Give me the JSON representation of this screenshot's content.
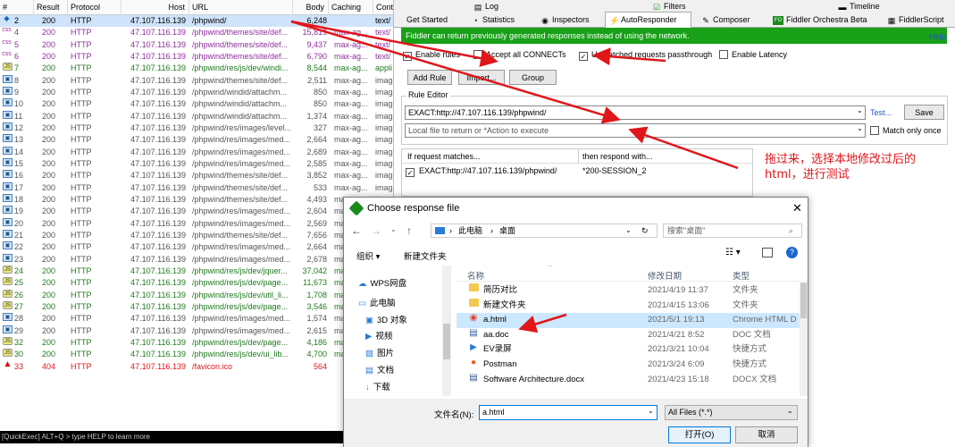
{
  "sessions": {
    "headers": [
      "#",
      "Result",
      "Protocol",
      "Host",
      "URL",
      "Body",
      "Caching",
      "Cont"
    ],
    "rows": [
      {
        "num": "2",
        "result": "200",
        "protocol": "HTTP",
        "host": "47.107.116.139",
        "url": "/phpwind/",
        "body": "6,248",
        "caching": "",
        "content": "text/",
        "icon": "nav",
        "color": "#000000"
      },
      {
        "num": "4",
        "result": "200",
        "protocol": "HTTP",
        "host": "47.107.116.139",
        "url": "/phpwind/themes/site/def...",
        "body": "15,819",
        "caching": "max-ag...",
        "content": "text/",
        "icon": "css",
        "color": "#8e2f9c"
      },
      {
        "num": "5",
        "result": "200",
        "protocol": "HTTP",
        "host": "47.107.116.139",
        "url": "/phpwind/themes/site/def...",
        "body": "9,437",
        "caching": "max-ag...",
        "content": "text/",
        "icon": "css",
        "color": "#8e2f9c"
      },
      {
        "num": "6",
        "result": "200",
        "protocol": "HTTP",
        "host": "47.107.116.139",
        "url": "/phpwind/themes/site/def...",
        "body": "6,790",
        "caching": "max-ag...",
        "content": "text/",
        "icon": "css",
        "color": "#8e2f9c"
      },
      {
        "num": "7",
        "result": "200",
        "protocol": "HTTP",
        "host": "47.107.116.139",
        "url": "/phpwind/res/js/dev/windi...",
        "body": "8,544",
        "caching": "max-ag...",
        "content": "appli",
        "icon": "js",
        "color": "#1f7a1f"
      },
      {
        "num": "8",
        "result": "200",
        "protocol": "HTTP",
        "host": "47.107.116.139",
        "url": "/phpwind/themes/site/def...",
        "body": "2,511",
        "caching": "max-ag...",
        "content": "imag",
        "icon": "img",
        "color": "#555555"
      },
      {
        "num": "9",
        "result": "200",
        "protocol": "HTTP",
        "host": "47.107.116.139",
        "url": "/phpwind/windid/attachm...",
        "body": "850",
        "caching": "max-ag...",
        "content": "imag",
        "icon": "img",
        "color": "#555555"
      },
      {
        "num": "10",
        "result": "200",
        "protocol": "HTTP",
        "host": "47.107.116.139",
        "url": "/phpwind/windid/attachm...",
        "body": "850",
        "caching": "max-ag...",
        "content": "imag",
        "icon": "img",
        "color": "#555555"
      },
      {
        "num": "11",
        "result": "200",
        "protocol": "HTTP",
        "host": "47.107.116.139",
        "url": "/phpwind/windid/attachm...",
        "body": "1,374",
        "caching": "max-ag...",
        "content": "imag",
        "icon": "img",
        "color": "#555555"
      },
      {
        "num": "12",
        "result": "200",
        "protocol": "HTTP",
        "host": "47.107.116.139",
        "url": "/phpwind/res/images/level...",
        "body": "327",
        "caching": "max-ag...",
        "content": "imag",
        "icon": "img",
        "color": "#555555"
      },
      {
        "num": "13",
        "result": "200",
        "protocol": "HTTP",
        "host": "47.107.116.139",
        "url": "/phpwind/res/images/med...",
        "body": "2,664",
        "caching": "max-ag...",
        "content": "imag",
        "icon": "img",
        "color": "#555555"
      },
      {
        "num": "14",
        "result": "200",
        "protocol": "HTTP",
        "host": "47.107.116.139",
        "url": "/phpwind/res/images/med...",
        "body": "2,689",
        "caching": "max-ag...",
        "content": "imag",
        "icon": "img",
        "color": "#555555"
      },
      {
        "num": "15",
        "result": "200",
        "protocol": "HTTP",
        "host": "47.107.116.139",
        "url": "/phpwind/res/images/med...",
        "body": "2,585",
        "caching": "max-ag...",
        "content": "imag",
        "icon": "img",
        "color": "#555555"
      },
      {
        "num": "16",
        "result": "200",
        "protocol": "HTTP",
        "host": "47.107.116.139",
        "url": "/phpwind/themes/site/def...",
        "body": "3,852",
        "caching": "max-ag...",
        "content": "imag",
        "icon": "img",
        "color": "#555555"
      },
      {
        "num": "17",
        "result": "200",
        "protocol": "HTTP",
        "host": "47.107.116.139",
        "url": "/phpwind/themes/site/def...",
        "body": "533",
        "caching": "max-ag...",
        "content": "imag",
        "icon": "img",
        "color": "#555555"
      },
      {
        "num": "18",
        "result": "200",
        "protocol": "HTTP",
        "host": "47.107.116.139",
        "url": "/phpwind/themes/site/def...",
        "body": "4,493",
        "caching": "max-ag...",
        "content": "imag",
        "icon": "img",
        "color": "#555555"
      },
      {
        "num": "19",
        "result": "200",
        "protocol": "HTTP",
        "host": "47.107.116.139",
        "url": "/phpwind/res/images/med...",
        "body": "2,604",
        "caching": "ma",
        "content": "",
        "icon": "img",
        "color": "#555555"
      },
      {
        "num": "20",
        "result": "200",
        "protocol": "HTTP",
        "host": "47.107.116.139",
        "url": "/phpwind/res/images/med...",
        "body": "2,569",
        "caching": "ma",
        "content": "",
        "icon": "img",
        "color": "#555555"
      },
      {
        "num": "21",
        "result": "200",
        "protocol": "HTTP",
        "host": "47.107.116.139",
        "url": "/phpwind/themes/site/def...",
        "body": "7,656",
        "caching": "ma",
        "content": "",
        "icon": "img",
        "color": "#555555"
      },
      {
        "num": "22",
        "result": "200",
        "protocol": "HTTP",
        "host": "47.107.116.139",
        "url": "/phpwind/res/images/med...",
        "body": "2,664",
        "caching": "ma",
        "content": "",
        "icon": "img",
        "color": "#555555"
      },
      {
        "num": "23",
        "result": "200",
        "protocol": "HTTP",
        "host": "47.107.116.139",
        "url": "/phpwind/res/images/med...",
        "body": "2,678",
        "caching": "ma",
        "content": "",
        "icon": "img",
        "color": "#555555"
      },
      {
        "num": "24",
        "result": "200",
        "protocol": "HTTP",
        "host": "47.107.116.139",
        "url": "/phpwind/res/js/dev/jquer...",
        "body": "37,042",
        "caching": "ma",
        "content": "",
        "icon": "js",
        "color": "#1f7a1f"
      },
      {
        "num": "25",
        "result": "200",
        "protocol": "HTTP",
        "host": "47.107.116.139",
        "url": "/phpwind/res/js/dev/page...",
        "body": "11,673",
        "caching": "ma",
        "content": "",
        "icon": "js",
        "color": "#1f7a1f"
      },
      {
        "num": "26",
        "result": "200",
        "protocol": "HTTP",
        "host": "47.107.116.139",
        "url": "/phpwind/res/js/dev/util_li...",
        "body": "1,708",
        "caching": "ma",
        "content": "",
        "icon": "js",
        "color": "#1f7a1f"
      },
      {
        "num": "27",
        "result": "200",
        "protocol": "HTTP",
        "host": "47.107.116.139",
        "url": "/phpwind/res/js/dev/page...",
        "body": "3,546",
        "caching": "ma",
        "content": "",
        "icon": "js",
        "color": "#1f7a1f"
      },
      {
        "num": "28",
        "result": "200",
        "protocol": "HTTP",
        "host": "47.107.116.139",
        "url": "/phpwind/res/images/med...",
        "body": "1,574",
        "caching": "ma",
        "content": "",
        "icon": "img",
        "color": "#555555"
      },
      {
        "num": "29",
        "result": "200",
        "protocol": "HTTP",
        "host": "47.107.116.139",
        "url": "/phpwind/res/images/med...",
        "body": "2,615",
        "caching": "ma",
        "content": "",
        "icon": "img",
        "color": "#555555"
      },
      {
        "num": "32",
        "result": "200",
        "protocol": "HTTP",
        "host": "47.107.116.139",
        "url": "/phpwind/res/js/dev/page...",
        "body": "4,186",
        "caching": "ma",
        "content": "",
        "icon": "js",
        "color": "#1f7a1f"
      },
      {
        "num": "30",
        "result": "200",
        "protocol": "HTTP",
        "host": "47.107.116.139",
        "url": "/phpwind/res/js/dev/ui_lib...",
        "body": "4,700",
        "caching": "ma",
        "content": "",
        "icon": "js",
        "color": "#1f7a1f"
      },
      {
        "num": "33",
        "result": "404",
        "protocol": "HTTP",
        "host": "47.107.116.139",
        "url": "/favicon.ico",
        "body": "564",
        "caching": "",
        "content": "",
        "icon": "err",
        "color": "#e0161b"
      }
    ]
  },
  "statusbar": {
    "text": "[QuickExec] ALT+Q > type HELP to learn more"
  },
  "tabs_top": [
    {
      "label": "Log",
      "icon": "log-icon"
    },
    {
      "label": "Filters",
      "icon": "filter-icon"
    },
    {
      "label": "Timeline",
      "icon": "timeline-icon"
    }
  ],
  "tabs_main": [
    {
      "label": "Get Started",
      "icon": ""
    },
    {
      "label": "Statistics",
      "icon": "statistics-icon"
    },
    {
      "label": "Inspectors",
      "icon": "inspectors-icon"
    },
    {
      "label": "AutoResponder",
      "icon": "lightning-icon"
    },
    {
      "label": "Composer",
      "icon": "composer-icon"
    },
    {
      "label": "Fiddler Orchestra Beta",
      "icon": "fo-icon"
    },
    {
      "label": "FiddlerScript",
      "icon": "script-icon"
    }
  ],
  "autoresponder": {
    "banner": "Fiddler can return previously generated responses instead of using the network.",
    "help": "Help",
    "enable_rules": "Enable rules",
    "accept_connects": "Accept all CONNECTs",
    "unmatched_passthrough": "Unmatched requests passthrough",
    "enable_latency": "Enable Latency",
    "add_rule": "Add Rule",
    "import": "Import...",
    "group": "Group",
    "rule_editor": "Rule Editor",
    "match_value": "EXACT:http://47.107.116.139/phpwind/",
    "action_placeholder": "Local file to return or *Action to execute",
    "test": "Test...",
    "save": "Save",
    "match_only_once": "Match only once",
    "col_if": "If request matches...",
    "col_then": "then respond with...",
    "rule_match": "EXACT:http://47.107.116.139/phpwind/",
    "rule_response": "*200-SESSION_2"
  },
  "annotation": "拖过来，选择本地修改过后的html，进行测试",
  "dialog": {
    "title": "Choose response file",
    "breadcrumb_pc": "此电脑",
    "breadcrumb_desktop": "桌面",
    "search_placeholder": "搜索\"桌面\"",
    "organize": "组织 ▾",
    "new_folder": "新建文件夹",
    "nav": [
      {
        "label": "WPS网盘",
        "icon": "cloud-icon"
      },
      {
        "label": "此电脑",
        "icon": "computer-icon"
      },
      {
        "label": "3D 对象",
        "icon": "cube-icon"
      },
      {
        "label": "视频",
        "icon": "video-icon"
      },
      {
        "label": "图片",
        "icon": "picture-icon"
      },
      {
        "label": "文档",
        "icon": "document-icon"
      },
      {
        "label": "下载",
        "icon": "download-icon"
      }
    ],
    "col_name": "名称",
    "col_date": "修改日期",
    "col_type": "类型",
    "files": [
      {
        "name": "简历对比",
        "date": "2021/4/19 11:37",
        "type": "文件夹",
        "icon": "folder"
      },
      {
        "name": "新建文件夹",
        "date": "2021/4/15 13:06",
        "type": "文件夹",
        "icon": "folder"
      },
      {
        "name": "a.html",
        "date": "2021/5/1 19:13",
        "type": "Chrome HTML D",
        "icon": "chrome"
      },
      {
        "name": "aa.doc",
        "date": "2021/4/21 8:52",
        "type": "DOC 文档",
        "icon": "doc"
      },
      {
        "name": "EV录屏",
        "date": "2021/3/21 10:04",
        "type": "快捷方式",
        "icon": "ev"
      },
      {
        "name": "Postman",
        "date": "2021/3/24 6:09",
        "type": "快捷方式",
        "icon": "postman"
      },
      {
        "name": "Software Architecture.docx",
        "date": "2021/4/23 15:18",
        "type": "DOCX 文档",
        "icon": "doc"
      }
    ],
    "filename_label": "文件名(N):",
    "filename_value": "a.html",
    "filter": "All Files (*.*)",
    "open": "打开(O)",
    "cancel": "取消"
  },
  "colors": {
    "banner_green": "#18a018",
    "arrow_red": "#e0161b",
    "selection": "#cce8ff"
  }
}
